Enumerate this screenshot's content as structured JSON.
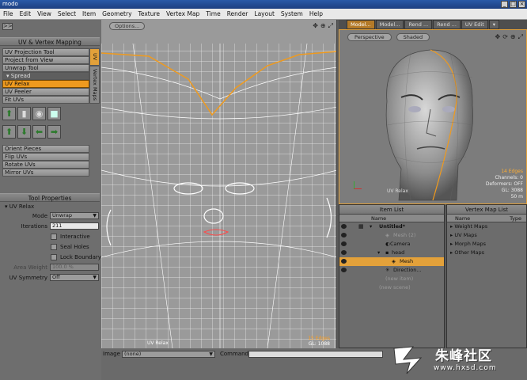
{
  "window": {
    "title": "modo"
  },
  "menu": [
    "File",
    "Edit",
    "View",
    "Select",
    "Item",
    "Geometry",
    "Texture",
    "Vertex Map",
    "Time",
    "Render",
    "Layout",
    "System",
    "Help"
  ],
  "left_panel": {
    "collapse_label": ">>",
    "uv_header": "UV & Vertex Mapping",
    "tools": [
      "UV Projection Tool",
      "Project from View",
      "Unwrap Tool"
    ],
    "spread_label": "Spread",
    "tools2": [
      "UV Relax",
      "UV Peeler",
      "Fit UVs"
    ],
    "active_tool": "UV Relax",
    "tools3": [
      "Orient Pieces",
      "Flip UVs",
      "Rotate UVs",
      "Mirror UVs"
    ],
    "vtab_uv": "UV",
    "vtab_vmaps": "Vertex Maps",
    "props_header": "Tool Properties",
    "props_title": "UV Relax",
    "mode_label": "Mode",
    "mode_value": "Unwrap",
    "iterations_label": "Iterations",
    "iterations_value": "211",
    "interactive_label": "Interactive",
    "seal_holes_label": "Seal Holes",
    "lock_boundary_label": "Lock Boundary",
    "area_weight_label": "Area Weight",
    "area_weight_value": "100.0 %",
    "uv_symmetry_label": "UV Symmetry",
    "uv_symmetry_value": "Off"
  },
  "uv_view": {
    "options_label": "Options...",
    "footer_left": "UV Relax",
    "footer_edges": "15 Edges",
    "footer_gl": "GL: 1088"
  },
  "bottom_bar": {
    "image_label": "Image",
    "image_value": "(none)",
    "command_label": "Command"
  },
  "right_tabs": [
    "Model...",
    "Model...",
    "Rend ...",
    "Rend ...",
    "UV Edit"
  ],
  "view3d": {
    "projection": "Perspective",
    "shading": "Shaded",
    "stats_edges": "14 Edges",
    "stats_channels": "Channels: 0",
    "stats_deformers": "Deformers: OFF",
    "stats_gl": "GL: 3088",
    "stats_dist": "50 m",
    "footer": "UV Relax"
  },
  "item_list": {
    "header": "Item List",
    "col_name": "Name",
    "rows": [
      "Untitled*",
      "Mesh (2)",
      "Camera",
      "head",
      "Mesh",
      "Direction...",
      "(new item)",
      "(new scene)"
    ]
  },
  "vertex_map_list": {
    "header": "Vertex Map List",
    "col_name": "Name",
    "col_type": "Type",
    "rows": [
      "Weight Maps",
      "UV Maps",
      "Morph Maps",
      "Other Maps"
    ]
  },
  "watermark": {
    "main": "朱峰社区",
    "url": "www.hxsd.com"
  },
  "colors": {
    "accent": "#e3a13a",
    "uv_bg": "#9a9a9a",
    "panel": "#6e6e6e"
  }
}
